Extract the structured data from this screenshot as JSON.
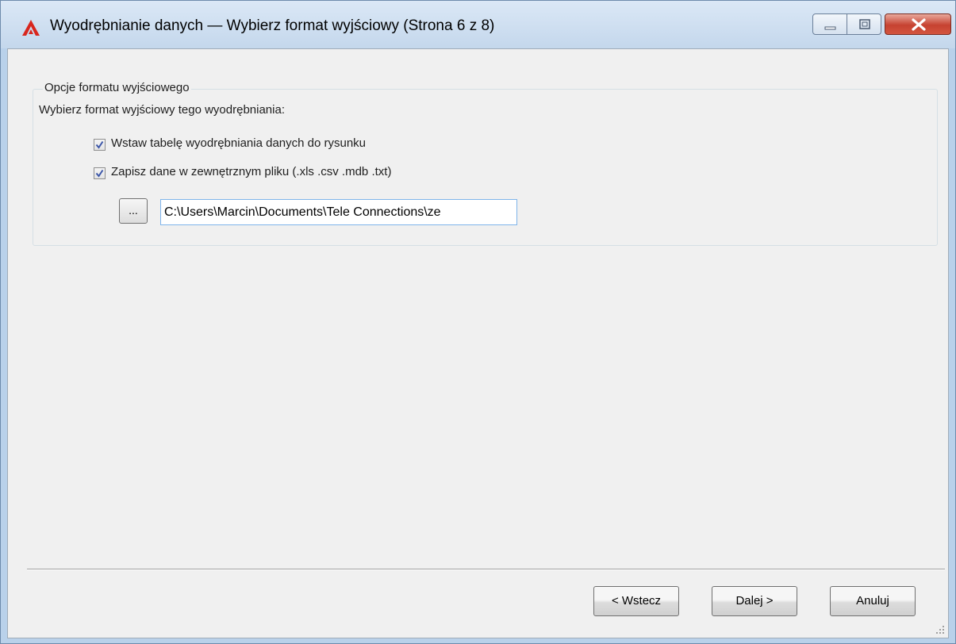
{
  "window": {
    "title": "Wyodrębnianie danych — Wybierz format wyjściowy (Strona 6 z 8)"
  },
  "group": {
    "title": "Opcje formatu wyjściowego",
    "prompt": "Wybierz format wyjściowy tego wyodrębniania:"
  },
  "options": [
    {
      "label": "Wstaw tabelę wyodrębniania danych do rysunku",
      "checked": true
    },
    {
      "label": "Zapisz dane w zewnętrznym pliku (.xls .csv .mdb .txt)",
      "checked": true
    }
  ],
  "file": {
    "browse_label": "...",
    "path": "C:\\Users\\Marcin\\Documents\\Tele Connections\\ze"
  },
  "buttons": {
    "back": "< Wstecz",
    "next": "Dalej >",
    "cancel": "Anuluj"
  },
  "icons": {
    "app": "autocad-icon",
    "minimize": "minimize-icon",
    "maximize": "maximize-icon",
    "close": "close-icon",
    "resize": "resize-grip-icon"
  }
}
